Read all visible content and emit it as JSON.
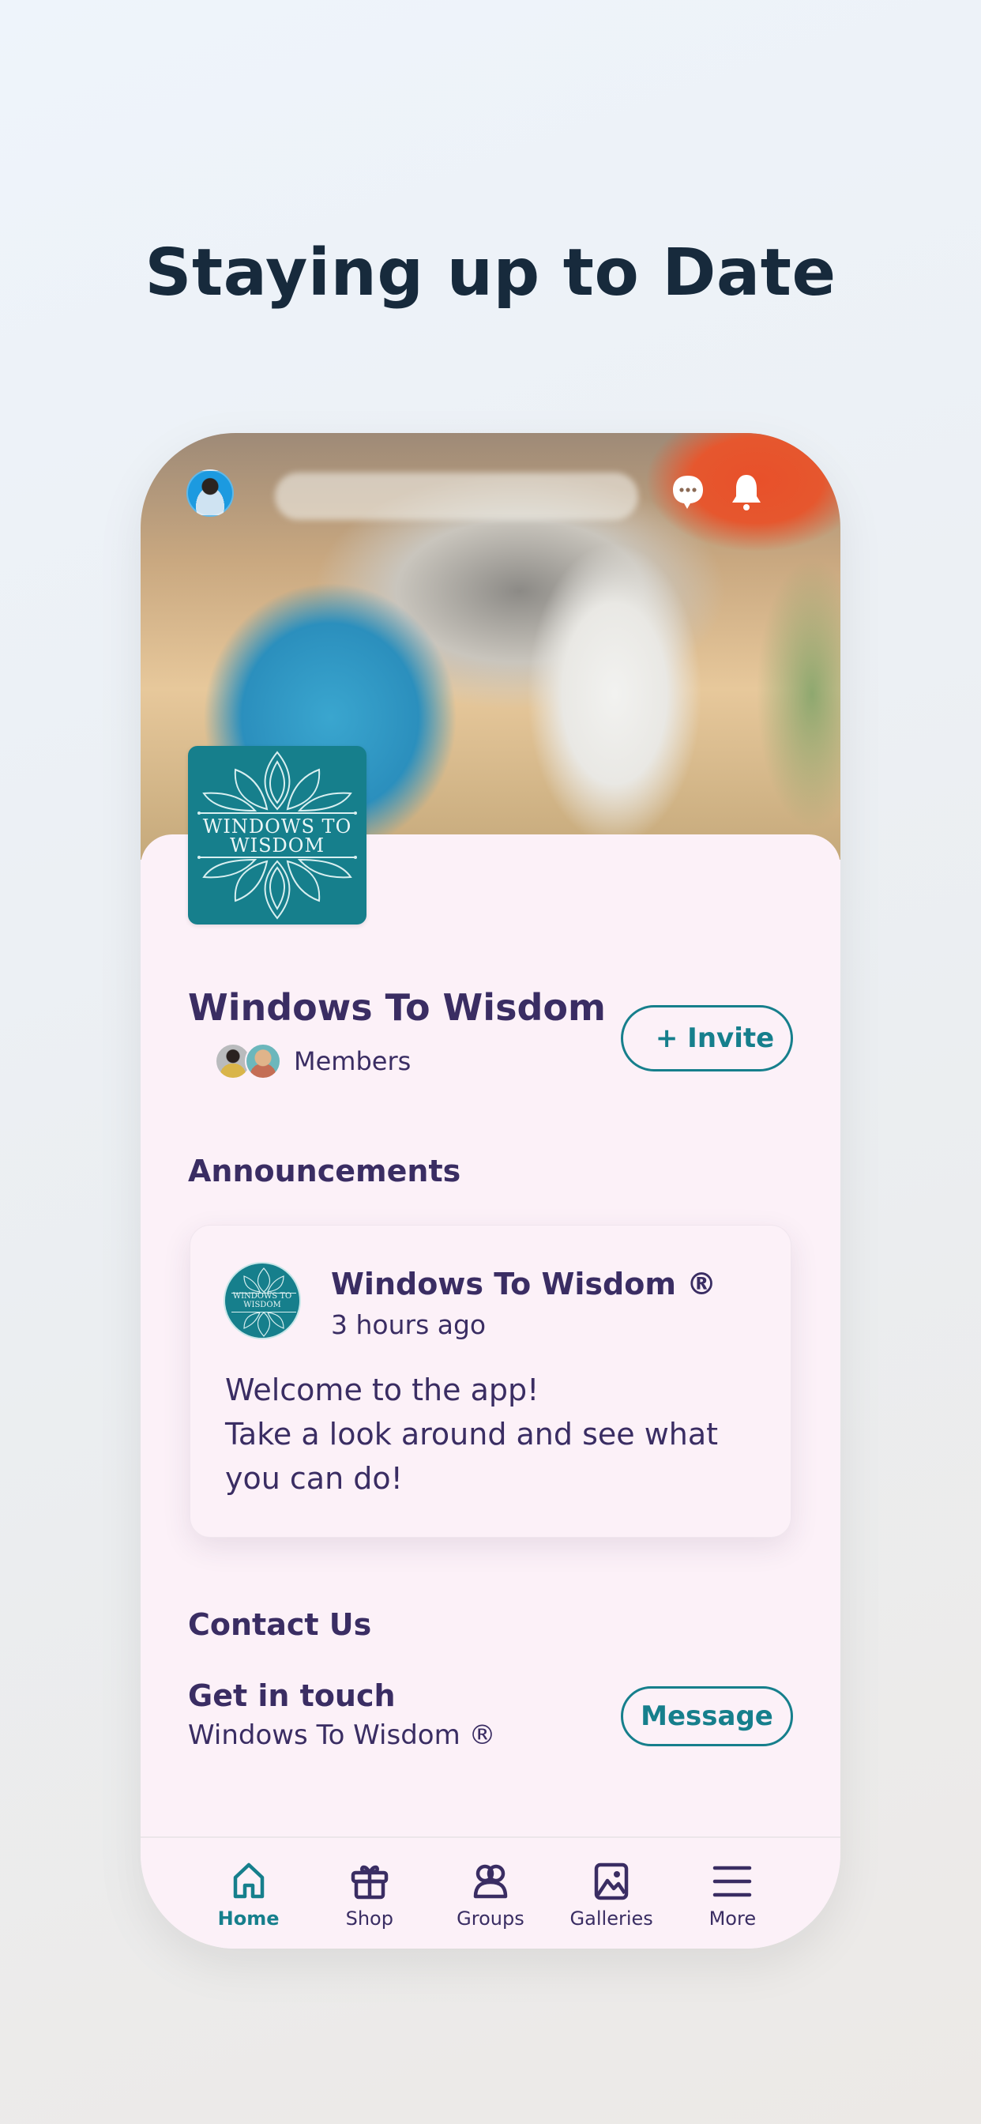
{
  "headline": "Staying up to Date",
  "colors": {
    "accent": "#167f8c",
    "text": "#3a2d63",
    "headline": "#172a3c",
    "surface": "#fcf1f8"
  },
  "header": {
    "profile_avatar": "user-avatar",
    "icons": [
      "chat-icon",
      "bell-icon"
    ]
  },
  "group": {
    "logo_text_line1": "WINDOWS TO",
    "logo_text_line2": "WISDOM",
    "name": "Windows To Wisdom",
    "members_label": "Members",
    "invite_label": "+ Invite"
  },
  "announcements": {
    "title": "Announcements",
    "items": [
      {
        "author": "Windows To Wisdom ®",
        "time": "3 hours ago",
        "avatar_text_line1": "WINDOWS TO",
        "avatar_text_line2": "WISDOM",
        "body_line1": "Welcome to the app!",
        "body_line2": "Take a look around and see what you can do!"
      }
    ]
  },
  "contact": {
    "title": "Contact Us",
    "heading": "Get in touch",
    "subtitle": "Windows To Wisdom ®",
    "message_label": "Message"
  },
  "tabbar": {
    "items": [
      {
        "label": "Home",
        "icon": "home-icon",
        "active": true
      },
      {
        "label": "Shop",
        "icon": "gift-icon",
        "active": false
      },
      {
        "label": "Groups",
        "icon": "groups-icon",
        "active": false
      },
      {
        "label": "Galleries",
        "icon": "image-icon",
        "active": false
      },
      {
        "label": "More",
        "icon": "menu-icon",
        "active": false
      }
    ]
  }
}
